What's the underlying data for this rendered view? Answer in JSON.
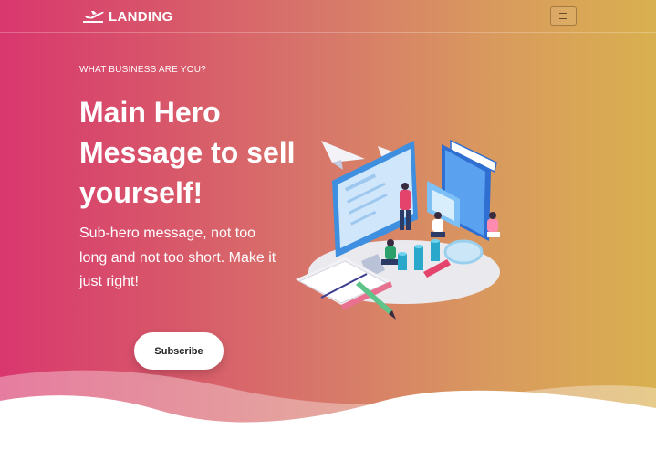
{
  "navbar": {
    "brand": "LANDING",
    "brand_icon": "airplane-takeoff-icon",
    "menu_icon": "hamburger-menu-icon"
  },
  "hero": {
    "eyebrow": "WHAT BUSINESS ARE YOU?",
    "headline": "Main Hero Message to sell yourself!",
    "subheadline": "Sub-hero message, not too long and not too short. Make it just right!",
    "cta_label": "Subscribe"
  },
  "colors": {
    "gradient_start": "#d9376e",
    "gradient_end": "#d9b04f",
    "text": "#ffffff",
    "button_bg": "#ffffff"
  }
}
